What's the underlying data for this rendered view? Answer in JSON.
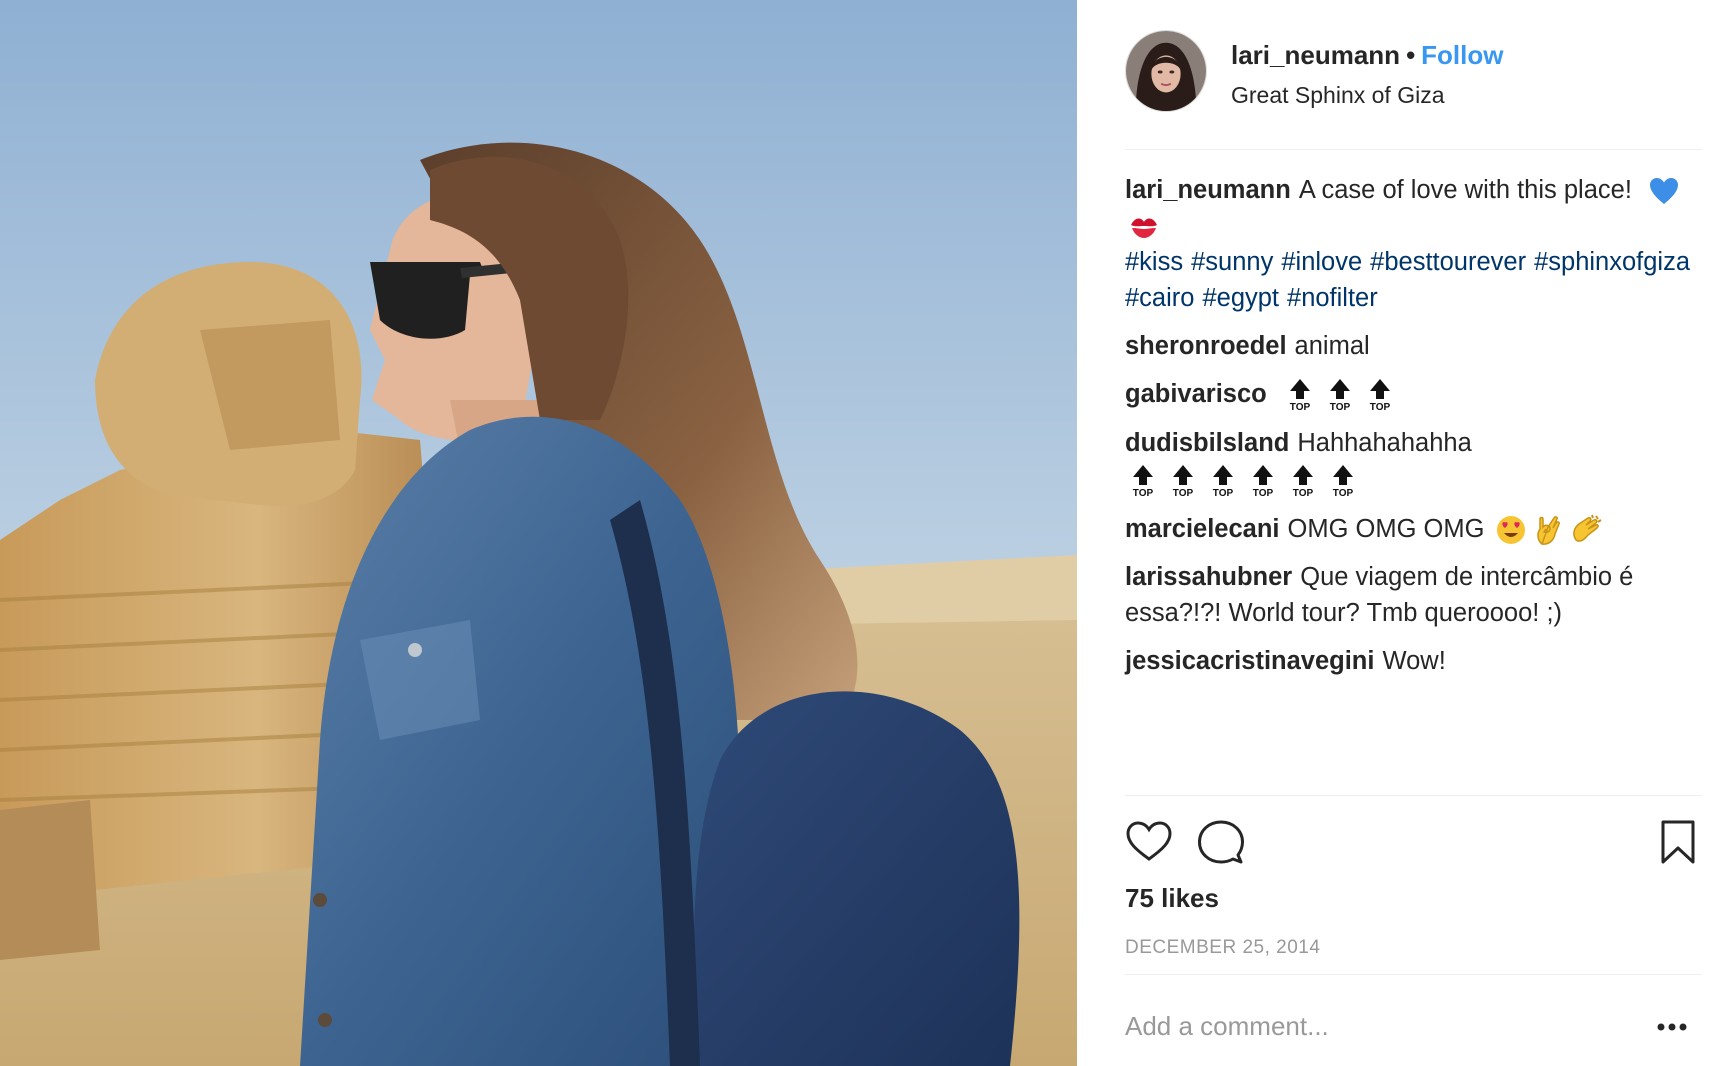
{
  "post": {
    "username": "lari_neumann",
    "separator": "•",
    "follow_label": "Follow",
    "location": "Great Sphinx of Giza",
    "avatar_icon": "profile-photo"
  },
  "caption": {
    "user": "lari_neumann",
    "text": "A case of love with this place!",
    "emojis": [
      "blue-heart-icon",
      "kiss-mark-icon"
    ],
    "hashtags": [
      "#kiss",
      "#sunny",
      "#inlove",
      "#besttourever",
      "#sphinxofgiza",
      "#cairo",
      "#egypt",
      "#nofilter"
    ]
  },
  "comments": [
    {
      "user": "sheronroedel",
      "text": "animal"
    },
    {
      "user": "gabivarisco",
      "text": "",
      "top_badge_count": 3,
      "badge_label": "TOP"
    },
    {
      "user": "dudisbilsland",
      "text": "Hahhahahahha",
      "top_badge_count": 6,
      "badge_label": "TOP"
    },
    {
      "user": "marcielecani",
      "text": "OMG OMG OMG",
      "emojis": [
        "heart-eyes-icon",
        "ok-hand-icon",
        "clapping-hands-icon"
      ]
    },
    {
      "user": "larissahubner",
      "text": "Que viagem de intercâmbio é essa?!?! World tour? Tmb queroooo! ;)"
    },
    {
      "user": "jessicacristinavegini",
      "text": "Wow!"
    }
  ],
  "actions": {
    "like_icon": "heart-outline-icon",
    "comment_icon": "speech-bubble-icon",
    "save_icon": "bookmark-icon"
  },
  "likes": "75 likes",
  "date": "DECEMBER 25, 2014",
  "comment_input": {
    "placeholder": "Add a comment...",
    "value": ""
  },
  "more_icon": "ellipsis-icon",
  "colors": {
    "link_blue": "#3897f0",
    "hashtag": "#003569",
    "text": "#262626",
    "muted": "#999999",
    "divider": "#efefef"
  }
}
